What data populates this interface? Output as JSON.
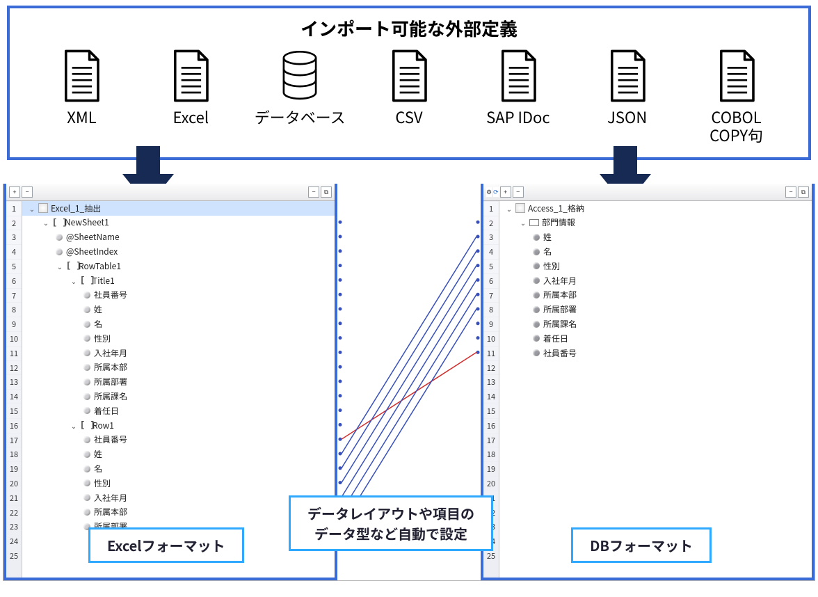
{
  "top": {
    "title": "インポート可能な外部定義",
    "items": [
      {
        "label": "XML",
        "type": "file"
      },
      {
        "label": "Excel",
        "type": "file"
      },
      {
        "label": "データベース",
        "type": "db"
      },
      {
        "label": "CSV",
        "type": "file"
      },
      {
        "label": "SAP IDoc",
        "type": "file"
      },
      {
        "label": "JSON",
        "type": "file"
      },
      {
        "label": "COBOL\nCOPY句",
        "type": "file"
      }
    ]
  },
  "callouts": {
    "mid_line1": "データレイアウトや項目の",
    "mid_line2": "データ型など自動で設定",
    "left": "Excelフォーマット",
    "right": "DBフォーマット"
  },
  "left_tree": {
    "root": "Excel_1_抽出",
    "rows": [
      {
        "n": 1,
        "d": 0,
        "t": "v",
        "i": "root",
        "l": "Excel_1_抽出",
        "sel": true
      },
      {
        "n": 2,
        "d": 1,
        "t": "v",
        "i": "brack",
        "l": "NewSheet1"
      },
      {
        "n": 3,
        "d": 2,
        "t": "",
        "i": "dot",
        "l": "@SheetName"
      },
      {
        "n": 4,
        "d": 2,
        "t": "",
        "i": "dot",
        "l": "@SheetIndex"
      },
      {
        "n": 5,
        "d": 2,
        "t": "v",
        "i": "brack",
        "l": "RowTable1"
      },
      {
        "n": 6,
        "d": 3,
        "t": "v",
        "i": "brack",
        "l": "Title1"
      },
      {
        "n": 7,
        "d": 4,
        "t": "",
        "i": "dot",
        "l": "社員番号"
      },
      {
        "n": 8,
        "d": 4,
        "t": "",
        "i": "dot",
        "l": "姓"
      },
      {
        "n": 9,
        "d": 4,
        "t": "",
        "i": "dot",
        "l": "名"
      },
      {
        "n": 10,
        "d": 4,
        "t": "",
        "i": "dot",
        "l": "性別"
      },
      {
        "n": 11,
        "d": 4,
        "t": "",
        "i": "dot",
        "l": "入社年月"
      },
      {
        "n": 12,
        "d": 4,
        "t": "",
        "i": "dot",
        "l": "所属本部"
      },
      {
        "n": 13,
        "d": 4,
        "t": "",
        "i": "dot",
        "l": "所属部署"
      },
      {
        "n": 14,
        "d": 4,
        "t": "",
        "i": "dot",
        "l": "所属課名"
      },
      {
        "n": 15,
        "d": 4,
        "t": "",
        "i": "dot",
        "l": "着任日"
      },
      {
        "n": 16,
        "d": 3,
        "t": "v",
        "i": "brack",
        "l": "Row1"
      },
      {
        "n": 17,
        "d": 4,
        "t": "",
        "i": "dot",
        "l": "社員番号"
      },
      {
        "n": 18,
        "d": 4,
        "t": "",
        "i": "dot",
        "l": "姓"
      },
      {
        "n": 19,
        "d": 4,
        "t": "",
        "i": "dot",
        "l": "名"
      },
      {
        "n": 20,
        "d": 4,
        "t": "",
        "i": "dot",
        "l": "性別"
      },
      {
        "n": 21,
        "d": 4,
        "t": "",
        "i": "dot",
        "l": "入社年月"
      },
      {
        "n": 22,
        "d": 4,
        "t": "",
        "i": "dot",
        "l": "所属本部"
      },
      {
        "n": 23,
        "d": 4,
        "t": "",
        "i": "dot",
        "l": "所属部署"
      },
      {
        "n": 24,
        "d": 0,
        "t": "",
        "i": "",
        "l": ""
      },
      {
        "n": 25,
        "d": 0,
        "t": "",
        "i": "",
        "l": ""
      }
    ]
  },
  "right_tree": {
    "root": "Access_1_格納",
    "rows": [
      {
        "n": 1,
        "d": 0,
        "t": "v",
        "i": "root",
        "l": "Access_1_格納"
      },
      {
        "n": 2,
        "d": 1,
        "t": "v",
        "i": "key",
        "l": "部門情報"
      },
      {
        "n": 3,
        "d": 2,
        "t": "",
        "i": "dotdk",
        "l": "姓"
      },
      {
        "n": 4,
        "d": 2,
        "t": "",
        "i": "dotdk",
        "l": "名"
      },
      {
        "n": 5,
        "d": 2,
        "t": "",
        "i": "dotdk",
        "l": "性別"
      },
      {
        "n": 6,
        "d": 2,
        "t": "",
        "i": "dotdk",
        "l": "入社年月"
      },
      {
        "n": 7,
        "d": 2,
        "t": "",
        "i": "dotdk",
        "l": "所属本部"
      },
      {
        "n": 8,
        "d": 2,
        "t": "",
        "i": "dotdk",
        "l": "所属部署"
      },
      {
        "n": 9,
        "d": 2,
        "t": "",
        "i": "dotdk",
        "l": "所属課名"
      },
      {
        "n": 10,
        "d": 2,
        "t": "",
        "i": "dotdk",
        "l": "着任日"
      },
      {
        "n": 11,
        "d": 2,
        "t": "",
        "i": "dotdk",
        "l": "社員番号"
      }
    ]
  },
  "mapping": {
    "left_src_rows": [
      17,
      18,
      19,
      20,
      21,
      22,
      23
    ],
    "left_dst_rows": [
      2,
      3,
      4,
      5,
      6,
      7,
      8,
      9,
      10,
      11
    ],
    "lines": [
      {
        "from": 17,
        "to": 11,
        "red": true
      },
      {
        "from": 18,
        "to": 3
      },
      {
        "from": 19,
        "to": 4
      },
      {
        "from": 20,
        "to": 5
      },
      {
        "from": 21,
        "to": 6
      },
      {
        "from": 22,
        "to": 7
      },
      {
        "from": 23,
        "to": 8
      }
    ]
  }
}
